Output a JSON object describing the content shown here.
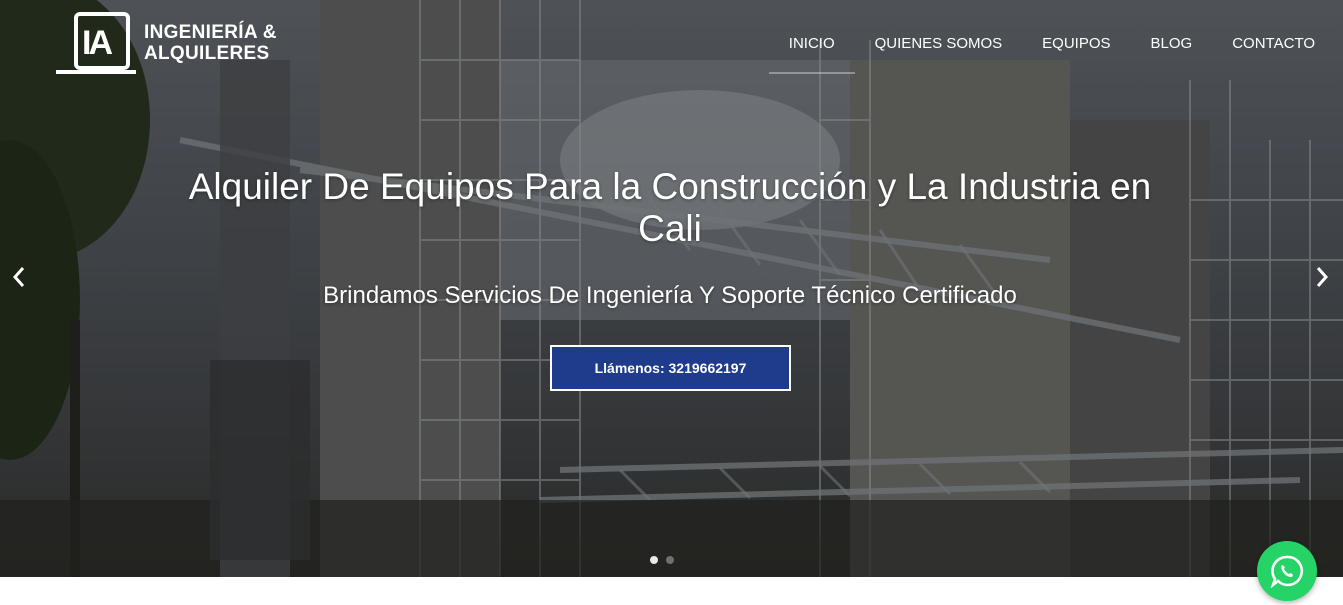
{
  "brand": {
    "mark": "IA",
    "line1": "INGENIERÍA &",
    "line2": "ALQUILERES"
  },
  "nav": {
    "items": [
      {
        "label": "INICIO",
        "active": true
      },
      {
        "label": "QUIENES SOMOS"
      },
      {
        "label": "EQUIPOS"
      },
      {
        "label": "BLOG"
      },
      {
        "label": "CONTACTO"
      }
    ]
  },
  "hero": {
    "title": "Alquiler De Equipos Para la Construcción y La Industria en Cali",
    "subtitle": "Brindamos Servicios De Ingeniería Y Soporte Técnico Certificado",
    "cta_label": "Llámenos: 3219662197",
    "prev_icon": "chevron-left-icon",
    "next_icon": "chevron-right-icon",
    "slides": 2,
    "active_slide": 1
  },
  "colors": {
    "cta_background": "#1f3b8c",
    "whatsapp": "#25d366"
  },
  "floating": {
    "whatsapp_icon": "whatsapp-icon"
  }
}
